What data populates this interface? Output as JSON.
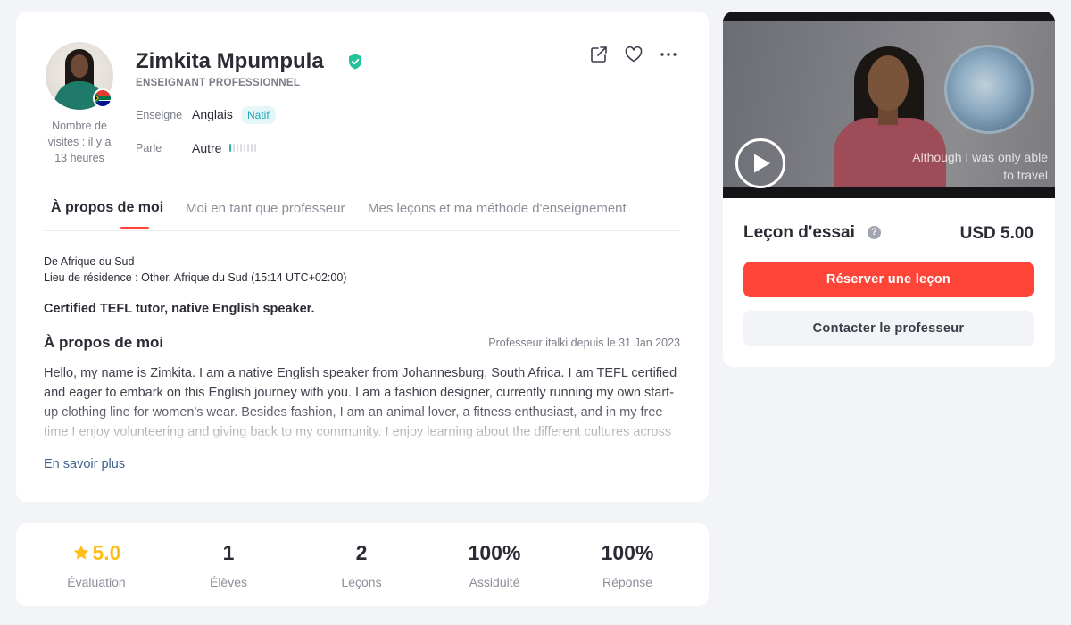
{
  "profile": {
    "name": "Zimkita Mpumpula",
    "role": "ENSEIGNANT PROFESSIONNEL",
    "visits": "Nombre de visites : il y a 13 heures",
    "teaches_label": "Enseigne",
    "teaches_value": "Anglais",
    "native_badge": "Natif",
    "speaks_label": "Parle",
    "speaks_value": "Autre",
    "speaks_level": 0.125,
    "flag": "south-africa-flag",
    "actions": [
      "share-icon",
      "heart-icon",
      "more-icon"
    ]
  },
  "tabs": [
    {
      "label": "À propos de moi",
      "active": true
    },
    {
      "label": "Moi en tant que professeur",
      "active": false
    },
    {
      "label": "Mes leçons et ma méthode d'enseignement",
      "active": false
    }
  ],
  "about": {
    "origin": "De Afrique du Sud",
    "residence": "Lieu de résidence : Other, Afrique du Sud (15:14 UTC+02:00)",
    "headline": "Certified TEFL tutor, native English speaker.",
    "title": "À propos de moi",
    "since": "Professeur italki depuis le 31 Jan 2023",
    "bio": "Hello, my name is Zimkita.  I am a native English speaker from Johannesburg, South Africa.  I am TEFL certified and eager to embark on this English journey with you. I am a fashion designer, currently running my own start-up clothing line for women's wear. Besides fashion, I am an animal lover, a fitness enthusiast, and in my free time I enjoy volunteering and giving back to my community. I enjoy learning about the different cultures across the world through traveling, meeting people and learning new languages.",
    "more": "En savoir plus"
  },
  "stats": [
    {
      "value": "5.0",
      "label": "Évaluation"
    },
    {
      "value": "1",
      "label": "Élèves"
    },
    {
      "value": "2",
      "label": "Leçons"
    },
    {
      "value": "100%",
      "label": "Assiduité"
    },
    {
      "value": "100%",
      "label": "Réponse"
    }
  ],
  "booking": {
    "subtitle_line1": "Although I was only able",
    "subtitle_line2": "to travel",
    "trial_label": "Leçon d'essai",
    "help": "?",
    "price": "USD 5.00",
    "book_button": "Réserver une leçon",
    "contact_button": "Contacter le professeur"
  },
  "colors": {
    "accent": "#ff4438",
    "verified": "#22c39a",
    "rating": "#ffbe1a",
    "native_badge_text": "#1fa5b8"
  }
}
